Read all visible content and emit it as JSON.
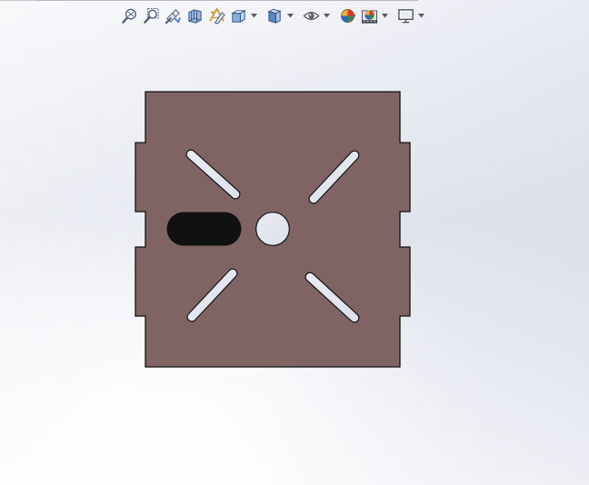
{
  "toolbar": {
    "buttons": [
      {
        "id": "zoom-to-fit",
        "icon": "zoom-to-fit-icon"
      },
      {
        "id": "zoom-to-area",
        "icon": "zoom-to-area-icon"
      },
      {
        "id": "previous-view",
        "icon": "previous-view-icon"
      },
      {
        "id": "section-view",
        "icon": "section-view-icon"
      },
      {
        "id": "dynamic-annotation-views",
        "icon": "dynamic-annotation-icon"
      },
      {
        "id": "view-orientation",
        "icon": "view-orientation-icon",
        "dropdown": true
      },
      {
        "id": "display-style",
        "icon": "display-style-icon",
        "dropdown": true
      },
      {
        "id": "hide-show-items",
        "icon": "eye-icon",
        "dropdown": true
      },
      {
        "id": "edit-appearance",
        "icon": "appearance-icon"
      },
      {
        "id": "apply-scene",
        "icon": "scene-icon",
        "dropdown": true
      },
      {
        "id": "view-settings",
        "icon": "monitor-icon",
        "dropdown": true
      }
    ]
  },
  "model": {
    "face_color": "#806464",
    "edge_color": "#111111",
    "cutout_fill": "#e3e6ef"
  }
}
